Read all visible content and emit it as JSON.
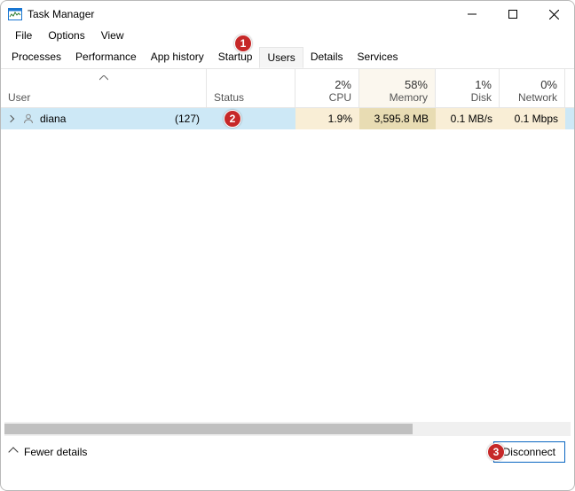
{
  "titlebar": {
    "app_icon": "task-manager-icon",
    "title": "Task Manager"
  },
  "menu": {
    "file": "File",
    "options": "Options",
    "view": "View"
  },
  "tabs": {
    "processes": "Processes",
    "performance": "Performance",
    "app_history": "App history",
    "startup": "Startup",
    "users": "Users",
    "details": "Details",
    "services": "Services"
  },
  "columns": {
    "user": "User",
    "status": "Status",
    "cpu_pct": "2%",
    "cpu_lbl": "CPU",
    "mem_pct": "58%",
    "mem_lbl": "Memory",
    "disk_pct": "1%",
    "disk_lbl": "Disk",
    "net_pct": "0%",
    "net_lbl": "Network"
  },
  "rows": [
    {
      "username": "diana",
      "process_count": "(127)",
      "status": "",
      "cpu": "1.9%",
      "memory": "3,595.8 MB",
      "disk": "0.1 MB/s",
      "network": "0.1 Mbps"
    }
  ],
  "footer": {
    "fewer_details": "Fewer details",
    "disconnect": "Disconnect"
  },
  "callouts": {
    "c1": "1",
    "c2": "2",
    "c3": "3"
  }
}
